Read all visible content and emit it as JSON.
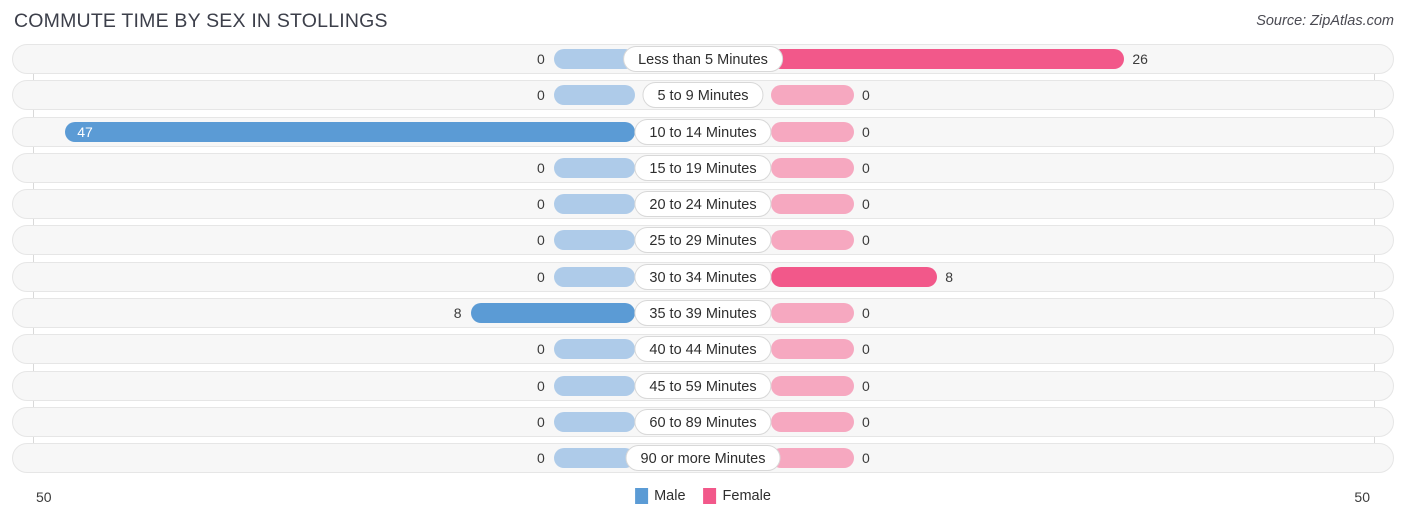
{
  "header": {
    "title": "COMMUTE TIME BY SEX IN STOLLINGS",
    "source": "Source: ZipAtlas.com"
  },
  "legend": {
    "male_label": "Male",
    "female_label": "Female",
    "male_color": "#5b9bd5",
    "female_color": "#f2588a"
  },
  "axis": {
    "left_label": "50",
    "right_label": "50",
    "max": 50
  },
  "chart_data": {
    "type": "bar",
    "orientation": "horizontal-diverging",
    "title": "COMMUTE TIME BY SEX IN STOLLINGS",
    "xlabel": "",
    "ylabel": "",
    "xlim": [
      50,
      50
    ],
    "grid": true,
    "legend_position": "bottom-center",
    "categories": [
      "Less than 5 Minutes",
      "5 to 9 Minutes",
      "10 to 14 Minutes",
      "15 to 19 Minutes",
      "20 to 24 Minutes",
      "25 to 29 Minutes",
      "30 to 34 Minutes",
      "35 to 39 Minutes",
      "40 to 44 Minutes",
      "45 to 59 Minutes",
      "60 to 89 Minutes",
      "90 or more Minutes"
    ],
    "series": [
      {
        "name": "Male",
        "color": "#5b9bd5",
        "values": [
          0,
          0,
          47,
          0,
          0,
          0,
          0,
          8,
          0,
          0,
          0,
          0
        ]
      },
      {
        "name": "Female",
        "color": "#f2588a",
        "values": [
          26,
          0,
          0,
          0,
          0,
          0,
          8,
          0,
          0,
          0,
          0,
          0
        ]
      }
    ]
  },
  "rows": [
    {
      "label": "Less than 5 Minutes",
      "male": "0",
      "female": "26"
    },
    {
      "label": "5 to 9 Minutes",
      "male": "0",
      "female": "0"
    },
    {
      "label": "10 to 14 Minutes",
      "male": "47",
      "female": "0"
    },
    {
      "label": "15 to 19 Minutes",
      "male": "0",
      "female": "0"
    },
    {
      "label": "20 to 24 Minutes",
      "male": "0",
      "female": "0"
    },
    {
      "label": "25 to 29 Minutes",
      "male": "0",
      "female": "0"
    },
    {
      "label": "30 to 34 Minutes",
      "male": "0",
      "female": "8"
    },
    {
      "label": "35 to 39 Minutes",
      "male": "8",
      "female": "0"
    },
    {
      "label": "40 to 44 Minutes",
      "male": "0",
      "female": "0"
    },
    {
      "label": "45 to 59 Minutes",
      "male": "0",
      "female": "0"
    },
    {
      "label": "60 to 89 Minutes",
      "male": "0",
      "female": "0"
    },
    {
      "label": "90 or more Minutes",
      "male": "0",
      "female": "0"
    }
  ]
}
